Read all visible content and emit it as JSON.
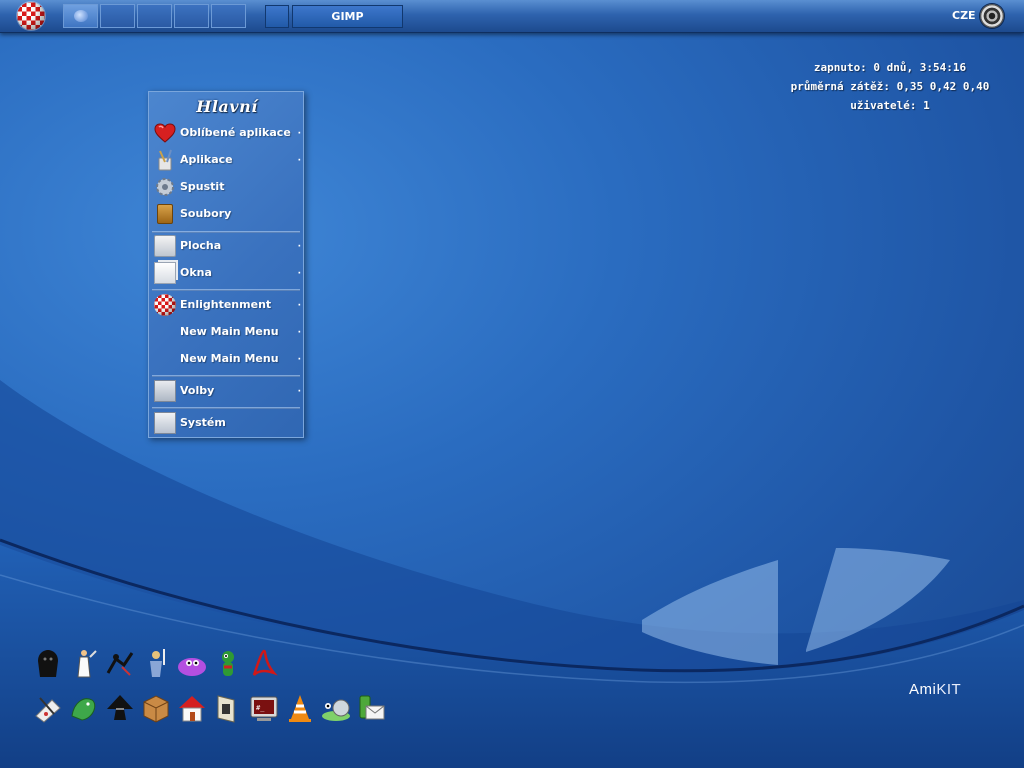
{
  "taskbar": {
    "pager_desks": 5,
    "task_button_label": "GIMP",
    "language": "CZE"
  },
  "sysinfo": {
    "uptime": "zapnuto: 0 dnů, 3:54:16",
    "load": "průměrná zátěž: 0,35 0,42 0,40",
    "users": "uživatelé: 1"
  },
  "menu": {
    "title": "Hlavní",
    "items": [
      {
        "label": "Oblíbené aplikace",
        "icon": "heart-icon",
        "submenu": true
      },
      {
        "label": "Aplikace",
        "icon": "brush-icon",
        "submenu": true
      },
      {
        "label": "Spustit",
        "icon": "gear-icon",
        "submenu": false
      },
      {
        "label": "Soubory",
        "icon": "folder-icon",
        "submenu": false
      },
      {
        "label": "Plocha",
        "icon": "desktop-icon",
        "submenu": true
      },
      {
        "label": "Okna",
        "icon": "windows-icon",
        "submenu": true
      },
      {
        "label": "Enlightenment",
        "icon": "boing-ball-icon",
        "submenu": true
      },
      {
        "label": "New Main Menu",
        "icon": "",
        "submenu": true
      },
      {
        "label": "New Main Menu",
        "icon": "",
        "submenu": true
      },
      {
        "label": "Volby",
        "icon": "preferences-icon",
        "submenu": true
      },
      {
        "label": "Systém",
        "icon": "system-icon",
        "submenu": false
      }
    ],
    "arrow_glyph": "·"
  },
  "dock": {
    "row1": [
      "gorilla-icon",
      "prince-of-persia-icon",
      "ninja-icon",
      "sword-warrior-icon",
      "purple-blob-icon",
      "green-creature-icon",
      "acrobat-icon"
    ],
    "row2": [
      "paint-palette-icon",
      "bird-icon",
      "inkscape-icon",
      "package-icon",
      "home-icon",
      "file-manager-icon",
      "terminal-icon",
      "vlc-icon",
      "snail-icon",
      "email-icon"
    ]
  },
  "branding": {
    "text_ami": "Ami",
    "text_kit": "KIT"
  },
  "colors": {
    "accent": "#2a6cc0",
    "menu_bg": "#3a72bf"
  }
}
